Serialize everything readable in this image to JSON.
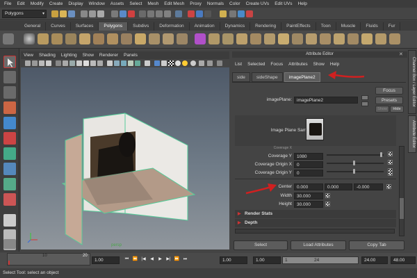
{
  "menubar": [
    "File",
    "Edit",
    "Modify",
    "Create",
    "Display",
    "Window",
    "Assets",
    "Select",
    "Mesh",
    "Edit Mesh",
    "Proxy",
    "Normals",
    "Color",
    "Create UVs",
    "Edit UVs",
    "Help"
  ],
  "statusline": {
    "mode": "Polygons"
  },
  "shelf_tabs": [
    "General",
    "Curves",
    "Surfaces",
    "Polygons",
    "Subdivs",
    "Deformation",
    "Animation",
    "Dynamics",
    "Rendering",
    "PaintEffects",
    "Toon",
    "Muscle",
    "Fluids",
    "Fur"
  ],
  "shelf_active": "Polygons",
  "viewport": {
    "menu": [
      "View",
      "Shading",
      "Lighting",
      "Show",
      "Renderer",
      "Panels"
    ],
    "camera_label": "persp"
  },
  "attribute_editor": {
    "title": "Attribute Editor",
    "menu": [
      "List",
      "Selected",
      "Focus",
      "Attributes",
      "Show",
      "Help"
    ],
    "tabs": [
      "side",
      "sideShape",
      "imagePlane2"
    ],
    "active_tab": "imagePlane2",
    "node_label": "imagePlane:",
    "node_value": "imagePlane2",
    "focus_btn": "Focus",
    "presets_btn": "Presets",
    "show_btn": "Show",
    "hide_btn": "Hide",
    "sample_label": "Image Plane Sample",
    "coverage_x_label": "Coverage X",
    "coverage_y_label": "Coverage Y",
    "coverage_y_value": "1080",
    "coverage_origin_x_label": "Coverage Origin X",
    "coverage_origin_x_value": "0",
    "coverage_origin_y_label": "Coverage Origin Y",
    "coverage_origin_y_value": "0",
    "center_label": "Center",
    "center_x": "0.000",
    "center_y": "0.000",
    "center_z": "-0.000",
    "width_label": "Width",
    "width_value": "30.000",
    "height_label": "Height",
    "height_value": "30.000",
    "sections": [
      "Render Stats",
      "Depth"
    ],
    "bottom_buttons": [
      "Select",
      "Load Attributes",
      "Copy Tab"
    ]
  },
  "side_tabs": [
    "Channel Box / Layer Editor",
    "Attribute Editor"
  ],
  "timeline": {
    "ticks": [
      "10",
      "20"
    ],
    "range_start": "1.00",
    "range_start2": "1.00",
    "current_start": "1.00",
    "current_frame": "1",
    "range_end": "24",
    "end_time": "24.00",
    "end_time2": "48.00"
  },
  "help_line": "Select Tool: select an object",
  "colors": {
    "accent_red": "#d02020",
    "panel": "#444444",
    "field": "#2b2b2b"
  }
}
